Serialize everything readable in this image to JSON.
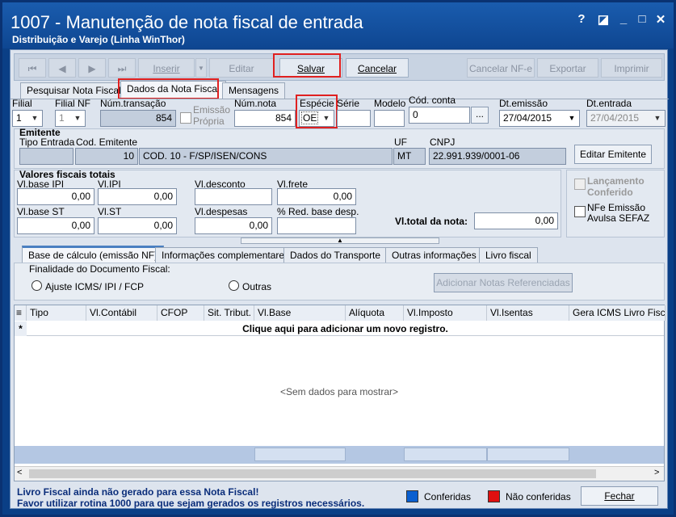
{
  "window": {
    "title": "1007 - Manutenção de nota fiscal de entrada",
    "subtitle": "Distribuição e Varejo (Linha WinThor)",
    "help": "?",
    "restore": "◪",
    "minimize": "_",
    "maximize": "□",
    "close": "✕"
  },
  "toolbar": {
    "first": "⏮",
    "prev": "◀",
    "next": "▶",
    "last": "⏭",
    "inserir": "Inserir",
    "editar": "Editar",
    "salvar": "Salvar",
    "cancelar": "Cancelar",
    "cancelar_nfe": "Cancelar NF-e",
    "exportar": "Exportar",
    "imprimir": "Imprimir"
  },
  "tabs": [
    "Pesquisar Nota Fiscal",
    "Dados da Nota Fiscal",
    "Mensagens"
  ],
  "header": {
    "filial_label": "Filial",
    "filial_value": "1",
    "filialnf_label": "Filial NF",
    "filialnf_value": "1",
    "numtransacao_label": "Núm.transação",
    "numtransacao_value": "854",
    "emissao_propria_label1": "Emissão",
    "emissao_propria_label2": "Própria",
    "numnota_label": "Núm.nota",
    "numnota_value": "854",
    "especie_label": "Espécie",
    "especie_value": "OE",
    "serie_label": "Série",
    "modelo_label": "Modelo",
    "codconta_label": "Cód. conta",
    "codconta_value": "0",
    "ellipsis": "...",
    "dtemissao_label": "Dt.emissão",
    "dtemissao_value": "27/04/2015",
    "dtentrada_label": "Dt.entrada",
    "dtentrada_value": "27/04/2015"
  },
  "emitente": {
    "section": "Emitente",
    "tipo_label": "Tipo Entrada",
    "cod_label": "Cod. Emitente",
    "cod_value": "10",
    "nome_value": "COD. 10 - F/SP/ISEN/CONS",
    "uf_label": "UF",
    "uf_value": "MT",
    "cnpj_label": "CNPJ",
    "cnpj_value": "22.991.939/0001-06",
    "editar_btn": "Editar Emitente"
  },
  "valores": {
    "section": "Valores fiscais totais",
    "base_ipi_label": "Vl.base IPI",
    "base_ipi": "0,00",
    "ipi_label": "Vl.IPI",
    "ipi": "0,00",
    "desconto_label": "Vl.desconto",
    "frete_label": "Vl.frete",
    "frete": "0,00",
    "base_st_label": "Vl.base ST",
    "base_st": "0,00",
    "st_label": "Vl.ST",
    "st": "0,00",
    "despesas_label": "Vl.despesas",
    "despesas": "0,00",
    "red_label": "% Red. base desp.",
    "total_label": "Vl.total da nota:",
    "total": "0,00"
  },
  "side": {
    "lanc1": "Lançamento",
    "lanc2": "Conferido",
    "nfe1": "NFe Emissão",
    "nfe2": "Avulsa SEFAZ"
  },
  "subtabs": [
    "Base de cálculo (emissão NF)",
    "Informações complementares",
    "Dados do Transporte",
    "Outras informações",
    "Livro fiscal"
  ],
  "base": {
    "finalidade_label": "Finalidade do Documento Fiscal:",
    "opt1": "Ajuste ICMS/ IPI / FCP",
    "opt2": "Outras",
    "add_btn": "Adicionar Notas Referenciadas"
  },
  "grid": {
    "columns": [
      "Tipo",
      "Vl.Contábil",
      "CFOP",
      "Sit. Tribut.",
      "Vl.Base",
      "Alíquota",
      "Vl.Imposto",
      "Vl.Isentas",
      "Gera ICMS Livro Fiscal"
    ],
    "new_row": "Clique aqui para adicionar um novo registro.",
    "new_marker": "*",
    "empty": "<Sem dados para mostrar>"
  },
  "footer": {
    "msg1": "Livro Fiscal ainda não gerado para essa Nota Fiscal!",
    "msg2": "Favor utilizar rotina 1000 para que sejam gerados os registros necessários.",
    "conferidas": "Conferidas",
    "nao_conferidas": "Não conferidas",
    "fechar": "Fechar"
  },
  "colors": {
    "conferidas": "#0a5fd0",
    "nao_conferidas": "#e01010"
  }
}
